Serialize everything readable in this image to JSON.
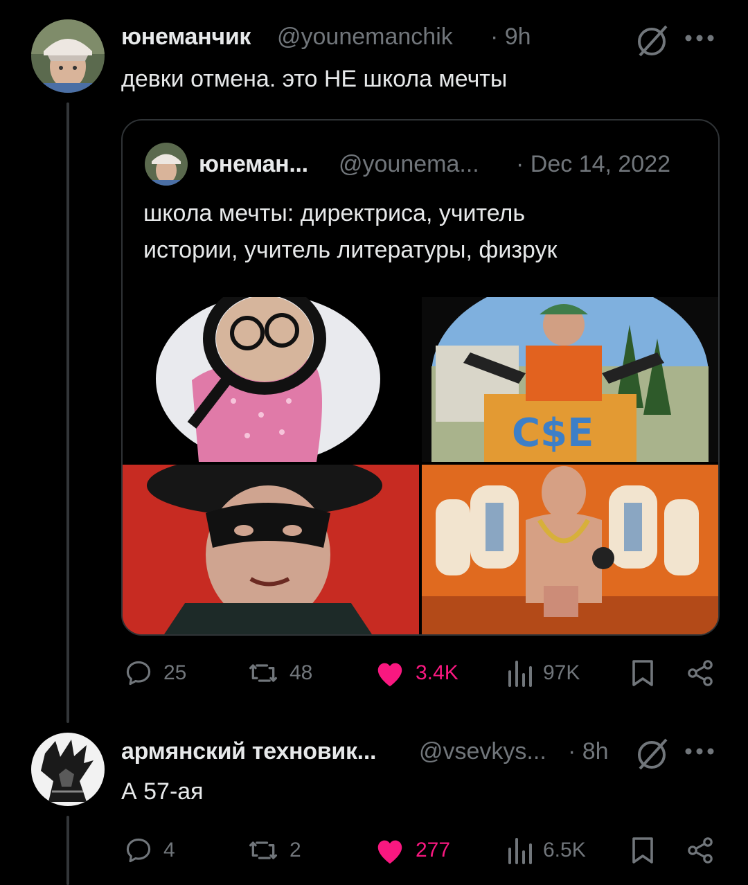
{
  "colors": {
    "background": "#000000",
    "text": "#e7e9ea",
    "secondary": "#71767b",
    "like": "#f91880",
    "border": "#2f3336"
  },
  "tweet1": {
    "author": {
      "name": "юнеманчик",
      "handle": "@younemanchik",
      "time": "· 9h"
    },
    "text": "девки отмена. это НЕ школа мечты",
    "quote": {
      "author": {
        "name": "юнеман...",
        "handle": "@younema...",
        "time": "· Dec 14, 2022"
      },
      "text_line1": "школа мечты: директриса, учитель",
      "text_line2": "истории, учитель литературы, физрук",
      "media": [
        "photo-magnifier-glass",
        "photo-trash-container",
        "photo-masked-man",
        "photo-gym-room"
      ]
    },
    "actions": {
      "replies": "25",
      "retweets": "48",
      "likes": "3.4K",
      "views": "97K"
    }
  },
  "tweet2": {
    "author": {
      "name": "армянский техновик...",
      "handle": "@vsevkys...",
      "time": "· 8h"
    },
    "text": "А 57-ая",
    "actions": {
      "replies": "4",
      "retweets": "2",
      "likes": "277",
      "views": "6.5K"
    }
  },
  "icons": [
    "grok-icon",
    "more-icon",
    "reply-icon",
    "retweet-icon",
    "like-icon",
    "views-icon",
    "bookmark-icon",
    "share-icon"
  ]
}
